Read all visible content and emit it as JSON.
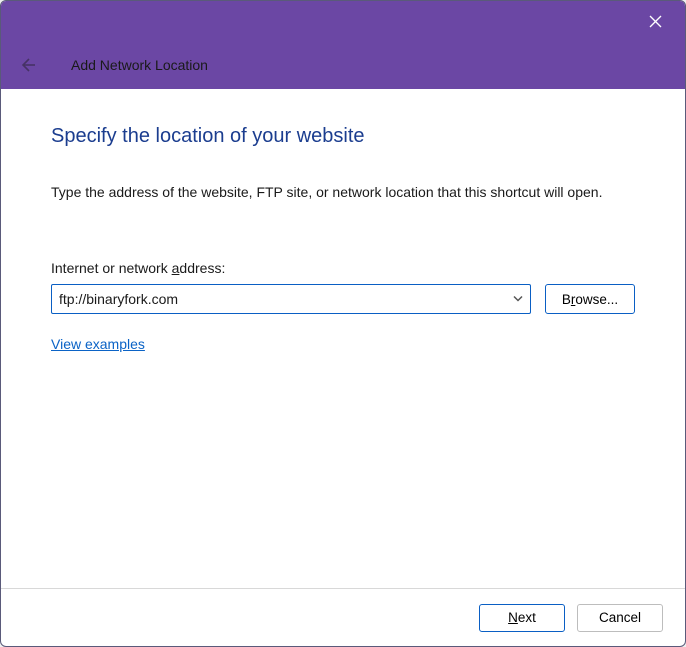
{
  "header": {
    "wizard_title": "Add Network Location"
  },
  "content": {
    "heading": "Specify the location of your website",
    "instruction": "Type the address of the website, FTP site, or network location that this shortcut will open.",
    "field_label_prefix": "Internet or network ",
    "field_label_ul": "a",
    "field_label_suffix": "ddress:",
    "address_value": "ftp://binaryfork.com",
    "browse_prefix": "B",
    "browse_ul": "r",
    "browse_suffix": "owse...",
    "examples_link": "View examples"
  },
  "footer": {
    "next_ul": "N",
    "next_suffix": "ext",
    "cancel": "Cancel"
  }
}
